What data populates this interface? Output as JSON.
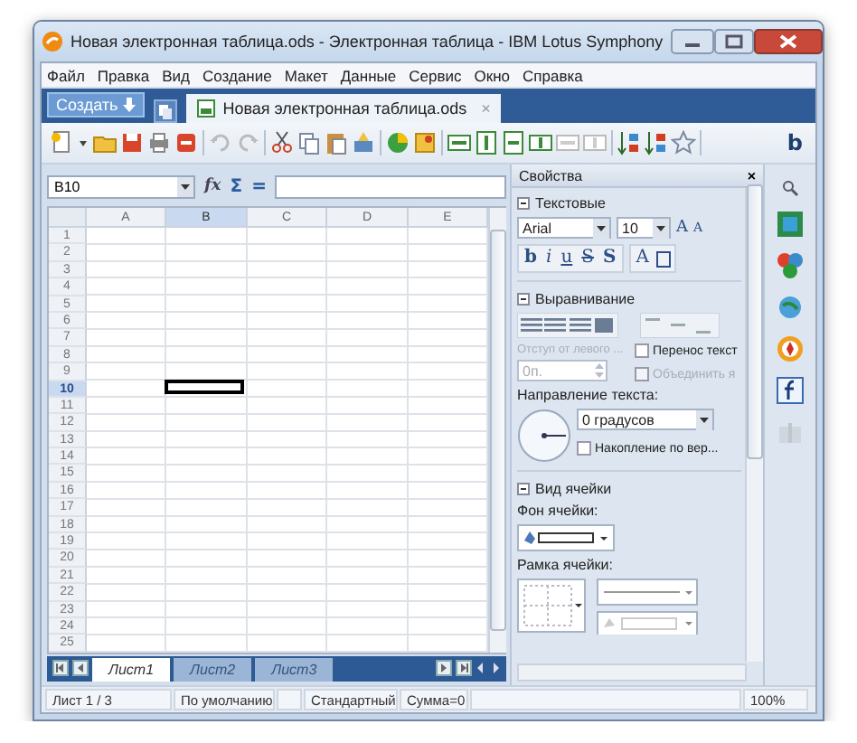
{
  "window": {
    "title": "Новая электронная таблица.ods - Электронная таблица - IBM Lotus Symphony"
  },
  "menu": [
    {
      "label": "Файл"
    },
    {
      "label": "Правка"
    },
    {
      "label": "Вид"
    },
    {
      "label": "Создание"
    },
    {
      "label": "Макет"
    },
    {
      "label": "Данные"
    },
    {
      "label": "Сервис"
    },
    {
      "label": "Окно"
    },
    {
      "label": "Справка"
    }
  ],
  "new_button": {
    "label": "Создать"
  },
  "doc_tabs": [
    {
      "label": "Новая электронная таблица.ods",
      "selected": true,
      "close": "×"
    }
  ],
  "toolbar": {
    "right_button": "b"
  },
  "formula_bar": {
    "cell_ref": "B10",
    "buttons": [
      "fx",
      "Σ",
      "="
    ]
  },
  "sheet": {
    "columns": [
      {
        "label": "A",
        "selected": false
      },
      {
        "label": "B",
        "selected": true
      },
      {
        "label": "C",
        "selected": false
      },
      {
        "label": "D",
        "selected": false
      },
      {
        "label": "E",
        "selected": false
      }
    ],
    "rows": [
      {
        "label": "1",
        "selected": false
      },
      {
        "label": "2",
        "selected": false
      },
      {
        "label": "3",
        "selected": false
      },
      {
        "label": "4",
        "selected": false
      },
      {
        "label": "5",
        "selected": false
      },
      {
        "label": "6",
        "selected": false
      },
      {
        "label": "7",
        "selected": false
      },
      {
        "label": "8",
        "selected": false
      },
      {
        "label": "9",
        "selected": false
      },
      {
        "label": "10",
        "selected": true
      },
      {
        "label": "11",
        "selected": false
      },
      {
        "label": "12",
        "selected": false
      },
      {
        "label": "13",
        "selected": false
      },
      {
        "label": "14",
        "selected": false
      },
      {
        "label": "15",
        "selected": false
      },
      {
        "label": "16",
        "selected": false
      },
      {
        "label": "17",
        "selected": false
      },
      {
        "label": "18",
        "selected": false
      },
      {
        "label": "19",
        "selected": false
      },
      {
        "label": "20",
        "selected": false
      },
      {
        "label": "21",
        "selected": false
      },
      {
        "label": "22",
        "selected": false
      },
      {
        "label": "23",
        "selected": false
      },
      {
        "label": "24",
        "selected": false
      },
      {
        "label": "25",
        "selected": false
      }
    ]
  },
  "sheet_tabs": [
    {
      "label": "Лист1",
      "selected": true
    },
    {
      "label": "Лист2",
      "selected": false
    },
    {
      "label": "Лист3",
      "selected": false
    }
  ],
  "properties": {
    "title": "Свойства",
    "close": "×",
    "text_section": {
      "title": "Текстовые",
      "expanded": true,
      "font": "Arial",
      "size": "10",
      "size_buttons": [
        "A",
        "A"
      ],
      "format_buttons": [
        "b",
        "i",
        "u",
        "S",
        "S"
      ],
      "border_button": "A"
    },
    "align_section": {
      "title": "Выравнивание",
      "expanded": true,
      "indent_label": "Отступ от левого ...",
      "indent_value": "0п.",
      "indent_disabled": true,
      "checkboxes": [
        {
          "label": "Перенос текст",
          "checked": false,
          "disabled": false
        },
        {
          "label": "Объединить я",
          "checked": false,
          "disabled": true
        }
      ],
      "direction_label": "Направление текста:",
      "angle": "0 градусов",
      "stack": {
        "label": "Накопление по вер...",
        "checked": false,
        "disabled": false
      }
    },
    "cell_section": {
      "title": "Вид ячейки",
      "expanded": true,
      "background_label": "Фон ячейки:",
      "border_label": "Рамка ячейки:"
    }
  },
  "status_bar": [
    {
      "text": "Лист 1 / 3"
    },
    {
      "text": "По умолчанию"
    },
    {
      "text": "Стандартный"
    },
    {
      "text": "Сумма=0"
    },
    {
      "text": "100%"
    }
  ]
}
